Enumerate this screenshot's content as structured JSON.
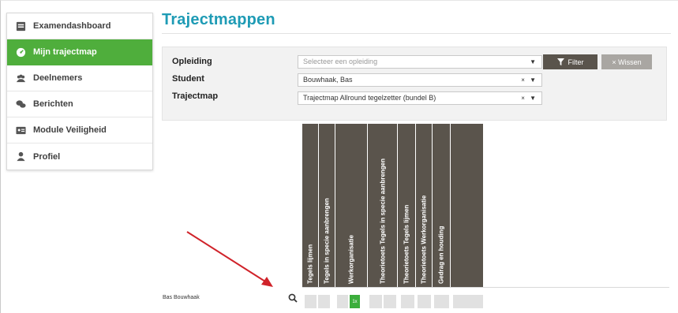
{
  "page": {
    "title": "Trajectmappen"
  },
  "sidebar": {
    "items": [
      {
        "label": "Examendashboard",
        "icon": "dashboard-icon",
        "active": false
      },
      {
        "label": "Mijn trajectmap",
        "icon": "speedometer-icon",
        "active": true
      },
      {
        "label": "Deelnemers",
        "icon": "users-icon",
        "active": false
      },
      {
        "label": "Berichten",
        "icon": "chat-icon",
        "active": false
      },
      {
        "label": "Module Veiligheid",
        "icon": "id-card-icon",
        "active": false
      },
      {
        "label": "Profiel",
        "icon": "user-icon",
        "active": false
      }
    ]
  },
  "filters": {
    "opleiding": {
      "label": "Opleiding",
      "placeholder": "Selecteer een opleiding",
      "control": "▼"
    },
    "student": {
      "label": "Student",
      "value": "Bouwhaak, Bas",
      "control": "× ▼"
    },
    "trajectmap": {
      "label": "Trajectmap",
      "value": "Trajectmap Allround tegelzetter (bundel B)",
      "control": "× ▼"
    },
    "filter_button": "Filter",
    "wissen_button": "× Wissen"
  },
  "grid": {
    "columns": [
      "Tegels lijmen",
      "Tegels in specie aanbrengen",
      "Werkorganisatie",
      "Theorietoets Tegels in specie aanbrengen",
      "Theorietoets Tegels lijmen",
      "Theorietoets Werkorganisatie",
      "Gedrag en houding"
    ],
    "row": {
      "student": "Bas Bouwhaak",
      "green_cell_label": "1x"
    }
  },
  "colors": {
    "accent_title": "#1e9bb5",
    "active_green": "#4fae3c",
    "header_brown": "#5a544c",
    "arrow_red": "#d0232a"
  }
}
